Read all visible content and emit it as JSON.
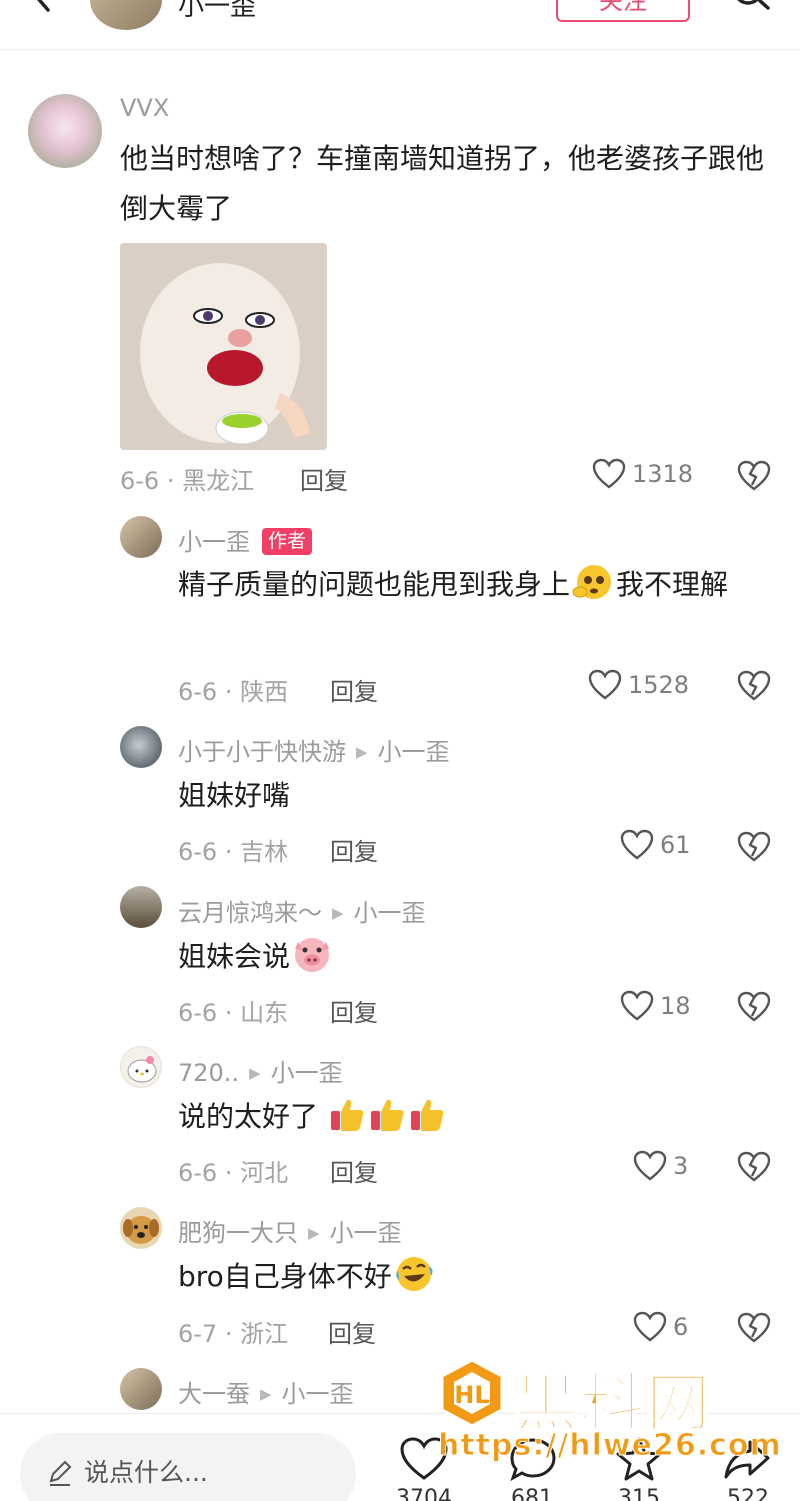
{
  "header": {
    "username": "小一歪",
    "follow_label": "关注"
  },
  "comments": [
    {
      "username": "VVX",
      "text": "他当时想啥了？车撞南墙知道拐了，他老婆孩子跟他倒大霉了",
      "date_location": "6-6 · 黑龙江",
      "reply_label": "回复",
      "likes": "1318"
    },
    {
      "username": "小一歪",
      "badge": "作者",
      "text": "精子质量的问题也能甩到我身上",
      "text_after_emoji": "我不理解",
      "date_location": "6-6 · 陕西",
      "reply_label": "回复",
      "likes": "1528"
    },
    {
      "username": "小于小于快快游",
      "reply_to": "小一歪",
      "text": "姐妹好嘴",
      "date_location": "6-6 · 吉林",
      "reply_label": "回复",
      "likes": "61"
    },
    {
      "username": "云月惊鸿来～",
      "reply_to": "小一歪",
      "text": "姐妹会说",
      "date_location": "6-6 · 山东",
      "reply_label": "回复",
      "likes": "18"
    },
    {
      "username": "720..",
      "reply_to": "小一歪",
      "text": "说的太好了",
      "date_location": "6-6 · 河北",
      "reply_label": "回复",
      "likes": "3"
    },
    {
      "username": "肥狗一大只",
      "reply_to": "小一歪",
      "text": "bro自己身体不好",
      "date_location": "6-7 · 浙江",
      "reply_label": "回复",
      "likes": "6"
    },
    {
      "username": "大一蚕",
      "reply_to": "小一歪"
    }
  ],
  "bottom_bar": {
    "input_placeholder": "说点什么...",
    "like_count": "3704",
    "comment_count": "681",
    "star_count": "315",
    "share_count": "522"
  },
  "watermark": {
    "title": "黑料网",
    "url": "https://hlwe26.com"
  },
  "colors": {
    "accent": "#f04a72",
    "badge": "#f13f65",
    "watermark": "#f29a13"
  },
  "icons": [
    "back-arrow-icon",
    "search-icon",
    "heart-icon",
    "broken-heart-icon",
    "pencil-icon",
    "comment-bubble-icon",
    "star-icon",
    "share-icon"
  ]
}
